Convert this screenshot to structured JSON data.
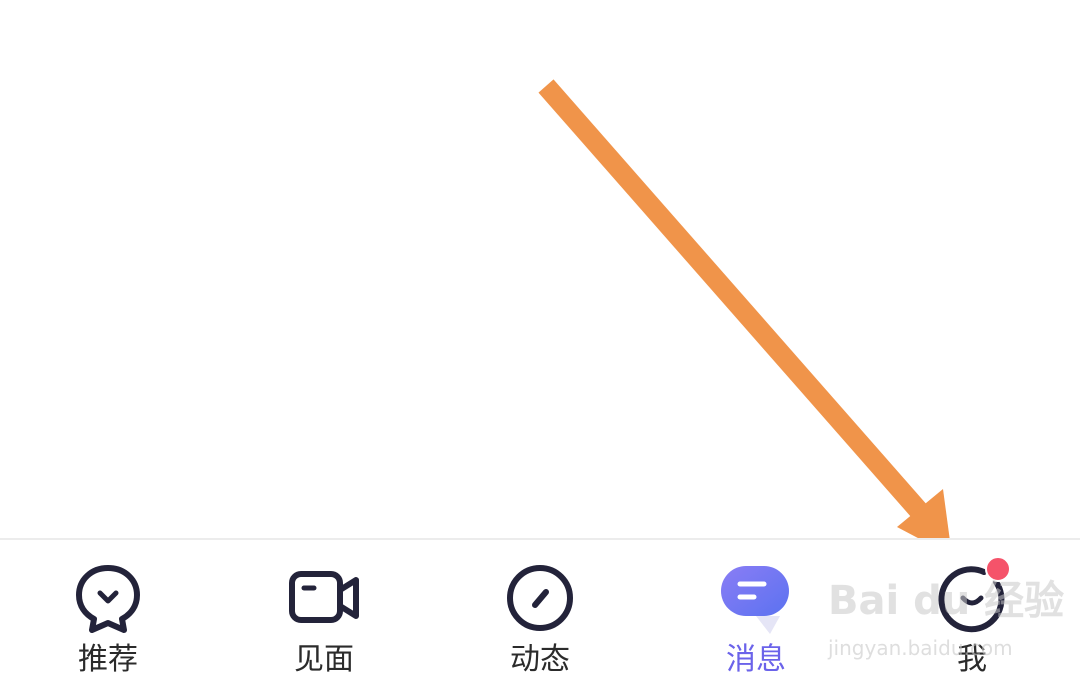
{
  "tabbar": {
    "tabs": [
      {
        "id": "recommend",
        "label": "推荐",
        "icon": "chat-heart-icon",
        "active": false,
        "badge": false
      },
      {
        "id": "meet",
        "label": "见面",
        "icon": "video-camera-icon",
        "active": false,
        "badge": false
      },
      {
        "id": "moments",
        "label": "动态",
        "icon": "compass-icon",
        "active": false,
        "badge": false
      },
      {
        "id": "messages",
        "label": "消息",
        "icon": "message-bubble-icon",
        "active": true,
        "badge": false
      },
      {
        "id": "me",
        "label": "我",
        "icon": "smiley-face-icon",
        "active": false,
        "badge": true
      }
    ]
  },
  "watermark": {
    "brand": "Bai du 经验",
    "url": "jingyan.baidu.com"
  },
  "colors": {
    "icon_stroke": "#23233a",
    "active_label": "#6b63ea",
    "active_icon_gradient": [
      "#8a7df5",
      "#5b72f0"
    ],
    "badge": "#f5536a",
    "annotation_arrow": "#f0944a",
    "label": "#2b2b2b"
  }
}
